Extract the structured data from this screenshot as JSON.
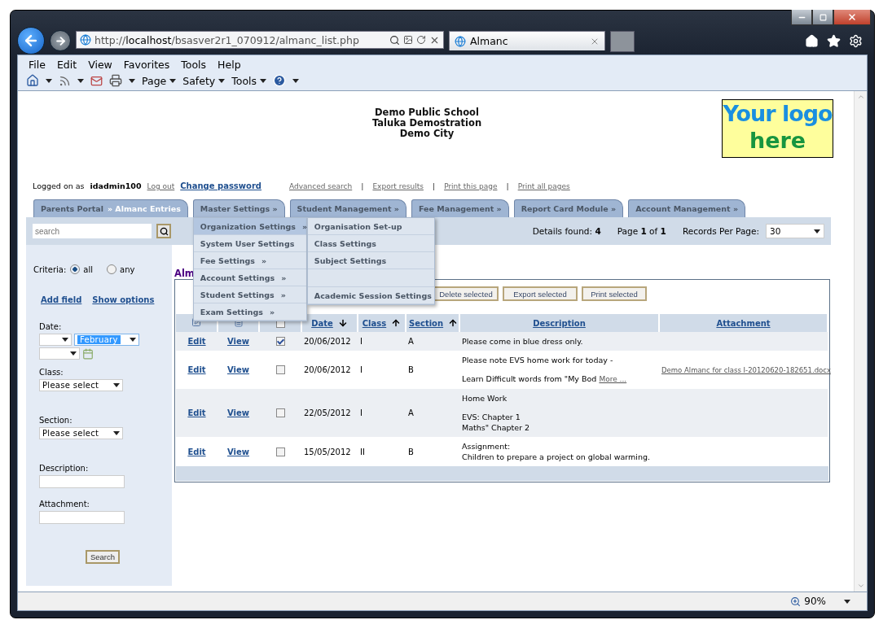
{
  "browser": {
    "url_scheme": "http://",
    "url_host": "localhost",
    "url_path": "/bsasver2r1_070912/almanc_list.php",
    "tab_title": "Almanc",
    "menu": [
      "File",
      "Edit",
      "View",
      "Favorites",
      "Tools",
      "Help"
    ],
    "commands": [
      "Page",
      "Safety",
      "Tools"
    ],
    "zoom": "90%"
  },
  "header": {
    "school_lines": [
      "Demo Public School",
      "Taluka Demostration",
      "Demo City"
    ],
    "logo_lines": [
      "Your logo",
      "here"
    ]
  },
  "userbar": {
    "separator": "|",
    "prefix": "Logged on as",
    "user": "idadmin100",
    "logout": "Log out",
    "change_password": "Change password",
    "actions": [
      "Advanced search",
      "Export results",
      "Print this page",
      "Print all pages"
    ]
  },
  "tabs": [
    {
      "label": "Parents Portal",
      "crumb": "» Almanc Entries",
      "expanded": false
    },
    {
      "label": "Master Settings  »",
      "expanded": true
    },
    {
      "label": "Student Management  »",
      "expanded": false
    },
    {
      "label": "Fee Management  »",
      "expanded": false
    },
    {
      "label": "Report Card Module  »",
      "expanded": false
    },
    {
      "label": "Account Management  »",
      "expanded": false
    }
  ],
  "menu": {
    "items": [
      {
        "label": "Organization Settings",
        "arrow": "»",
        "selected": true
      },
      {
        "label": "System User Settings",
        "selected": false
      },
      {
        "label": "Fee Settings",
        "arrow": "»",
        "selected": false
      },
      {
        "label": "Account Settings",
        "arrow": "»",
        "selected": false
      },
      {
        "label": "Student Settings",
        "arrow": "»",
        "selected": false
      },
      {
        "label": "Exam Settings",
        "arrow": "»",
        "selected": false
      }
    ],
    "submenu": [
      {
        "kind": "item",
        "label": "Organisation Set-up"
      },
      {
        "kind": "item",
        "label": "Class Settings"
      },
      {
        "kind": "item",
        "label": "Subject Settings"
      },
      {
        "kind": "blank"
      },
      {
        "kind": "item",
        "label": "Academic Session Settings"
      }
    ]
  },
  "search": {
    "placeholder": "search"
  },
  "paging": {
    "details": "Details found: **4**",
    "page": "Page **1** of **1**",
    "rpp_label": "Records Per Page:",
    "rpp_value": "30"
  },
  "sidebar": {
    "criteria_label": "Criteria:",
    "criteria": [
      {
        "label": "all",
        "selected": true
      },
      {
        "label": "any",
        "selected": false
      }
    ],
    "links": [
      "Add field",
      "Show options"
    ],
    "date_label": "Date:",
    "date_month": "February",
    "class_label": "Class:",
    "class_value": "Please select",
    "section_label": "Section:",
    "section_value": "Please select",
    "description_label": "Description:",
    "attachment_label": "Attachment:",
    "search_button": "Search"
  },
  "content": {
    "title": "Alm",
    "buttons": [
      "Delete selected",
      "Export selected",
      "Print selected"
    ],
    "columns": [
      {
        "kind": "edit"
      },
      {
        "kind": "view"
      },
      {
        "kind": "check",
        "checked": false
      },
      {
        "kind": "sort",
        "label": "Date",
        "sort_ascending": false
      },
      {
        "kind": "sort",
        "label": "Class",
        "sort_ascending": true
      },
      {
        "kind": "sort",
        "label": "Section",
        "sort_ascending": true
      },
      {
        "kind": "text",
        "label": "Description"
      },
      {
        "kind": "text",
        "label": "Attachment"
      }
    ],
    "rows": [
      {
        "edit": "Edit",
        "view": "View",
        "checked": true,
        "date": "20/06/2012",
        "class": "I",
        "section": "A",
        "description": [
          [
            "Please come in blue dress only."
          ]
        ]
      },
      {
        "edit": "Edit",
        "view": "View",
        "checked": false,
        "date": "20/06/2012",
        "class": "I",
        "section": "B",
        "description": [
          [
            "Please note EVS home work for today -"
          ],
          [
            "Learn Difficult words from \"My Bod"
          ]
        ],
        "more": "More ...",
        "attachment": "Demo Almanc for class I-20120620-182651.docx"
      },
      {
        "edit": "Edit",
        "view": "View",
        "checked": false,
        "date": "22/05/2012",
        "class": "I",
        "section": "A",
        "description": [
          [
            "Home Work"
          ],
          [
            "EVS: Chapter 1",
            "Maths\" Chapter 2"
          ]
        ]
      },
      {
        "edit": "Edit",
        "view": "View",
        "checked": false,
        "date": "15/05/2012",
        "class": "II",
        "section": "B",
        "description": [
          [
            "Assignment:",
            "Children to prepare a project on global warming."
          ]
        ]
      }
    ]
  }
}
